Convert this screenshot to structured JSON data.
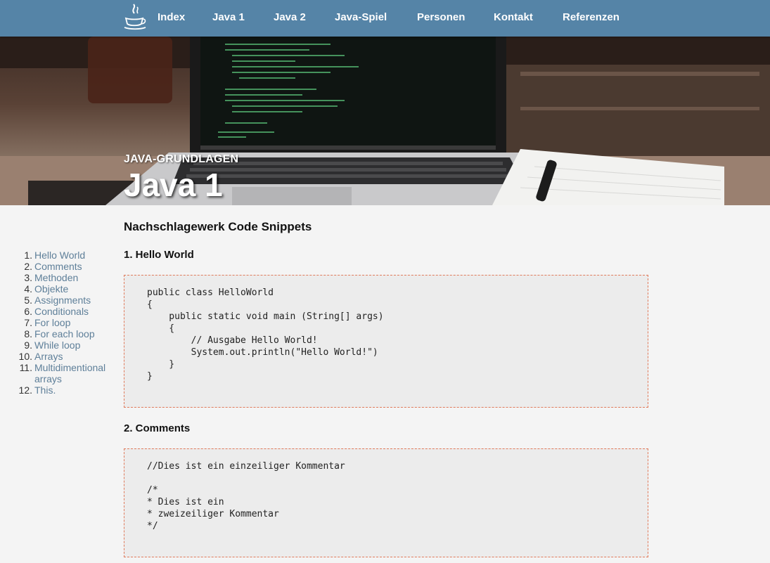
{
  "nav": {
    "items": [
      "Index",
      "Java 1",
      "Java 2",
      "Java-Spiel",
      "Personen",
      "Kontakt",
      "Referenzen"
    ]
  },
  "hero": {
    "kicker": "JAVA-GRUNDLAGEN",
    "title": "Java 1"
  },
  "main": {
    "heading": "Nachschlagewerk Code Snippets",
    "sections": [
      {
        "title": "1. Hello World",
        "code": "public class HelloWorld\n{\n    public static void main (String[] args)\n    {\n        // Ausgabe Hello World!\n        System.out.println(\"Hello World!\")\n    }\n}"
      },
      {
        "title": "2. Comments",
        "code": "//Dies ist ein einzeiliger Kommentar\n\n/*\n* Dies ist ein\n* zweizeiliger Kommentar\n*/"
      }
    ]
  },
  "toc": {
    "items": [
      {
        "num": "1.",
        "label": "Hello World"
      },
      {
        "num": "2.",
        "label": "Comments"
      },
      {
        "num": "3.",
        "label": "Methoden"
      },
      {
        "num": "4.",
        "label": "Objekte"
      },
      {
        "num": "5.",
        "label": "Assignments"
      },
      {
        "num": "6.",
        "label": "Conditionals"
      },
      {
        "num": "7.",
        "label": "For loop"
      },
      {
        "num": "8.",
        "label": "For each loop"
      },
      {
        "num": "9.",
        "label": "While loop"
      },
      {
        "num": "10.",
        "label": "Arrays"
      },
      {
        "num": "11.",
        "label": "Multidimentional arrays"
      },
      {
        "num": "12.",
        "label": "This."
      }
    ]
  },
  "colors": {
    "nav_bg": "#5584a7",
    "link": "#5e7f99",
    "code_border": "#e07a5a",
    "code_bg": "#ececec",
    "page_bg": "#f4f4f4"
  },
  "icons": {
    "logo": "java-coffee-cup-icon"
  }
}
